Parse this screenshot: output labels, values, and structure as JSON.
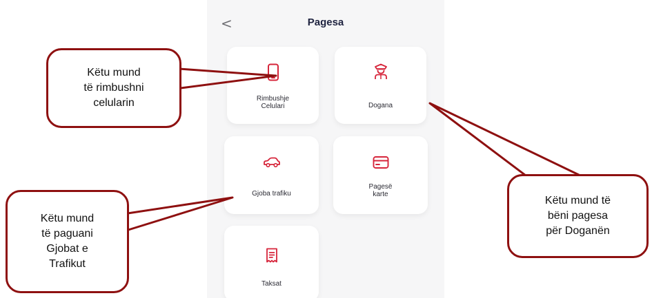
{
  "header": {
    "back_glyph": "<",
    "title": "Pagesa"
  },
  "tiles": [
    {
      "id": "rimbushje",
      "label": "Rimbushje\nCelulari",
      "icon": "phone-icon"
    },
    {
      "id": "dogana",
      "label": "Dogana",
      "icon": "customs-officer-icon"
    },
    {
      "id": "gjoba",
      "label": "Gjoba trafiku",
      "icon": "car-icon"
    },
    {
      "id": "karte",
      "label": "Pagesë\nkarte",
      "icon": "credit-card-icon"
    },
    {
      "id": "taksat",
      "label": "Taksat",
      "icon": "receipt-icon"
    }
  ],
  "callouts": {
    "celular": "Këtu mund\ntë rimbushni\ncelularin",
    "gjobat": "Këtu mund\ntë paguani\nGjobat e\nTrafikut",
    "dogana": "Këtu mund të\nbëni pagesa\npër Doganën"
  },
  "colors": {
    "accent_red": "#d6243a",
    "callout_border": "#8e1010",
    "background": "#f6f6f7"
  }
}
